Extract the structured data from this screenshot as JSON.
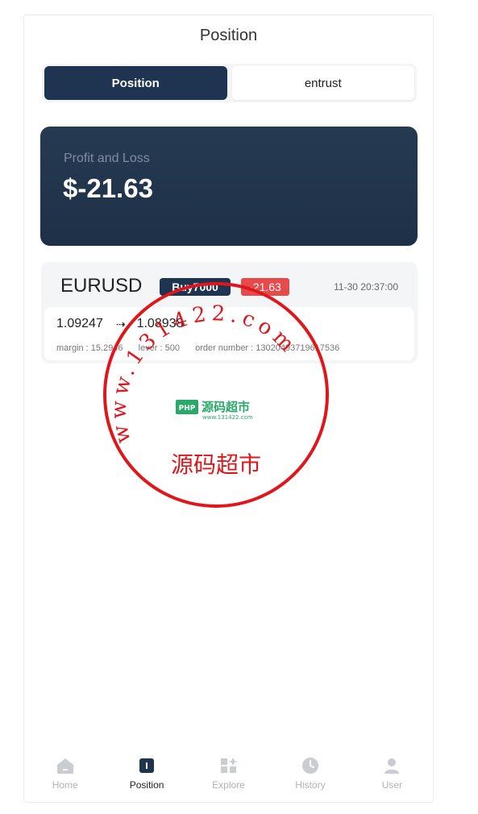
{
  "header": {
    "title": "Position"
  },
  "segments": {
    "active": "Position",
    "inactive": "entrust"
  },
  "pnl_card": {
    "label": "Profit and Loss",
    "value": "$-21.63"
  },
  "order": {
    "symbol": "EURUSD",
    "side_badge": "Buy7000",
    "pnl_badge": "-21.63",
    "time": "11-30 20:37:00",
    "open_price": "1.09247",
    "current_price": "1.08938",
    "margin_text": "margin : 15.2946",
    "lever_text": "lever : 500",
    "order_number_text": "order number : 13020493719617536"
  },
  "watermark": {
    "arc_text": "www.131422.com",
    "bottom_text": "源码超市",
    "logo_text": "源码超市",
    "logo_badge": "PHP",
    "logo_sub": "www.131422.com"
  },
  "tabbar": {
    "items": [
      {
        "label": "Home",
        "icon": "home-icon",
        "active": false
      },
      {
        "label": "Position",
        "icon": "position-icon",
        "active": true
      },
      {
        "label": "Explore",
        "icon": "explore-icon",
        "active": false
      },
      {
        "label": "History",
        "icon": "clock-icon",
        "active": false
      },
      {
        "label": "User",
        "icon": "user-icon",
        "active": false
      }
    ]
  },
  "colors": {
    "navy": "#1e3451",
    "loss_red": "#e74a4a",
    "stamp_red": "#e0161b",
    "logo_green": "#2aa86a"
  }
}
